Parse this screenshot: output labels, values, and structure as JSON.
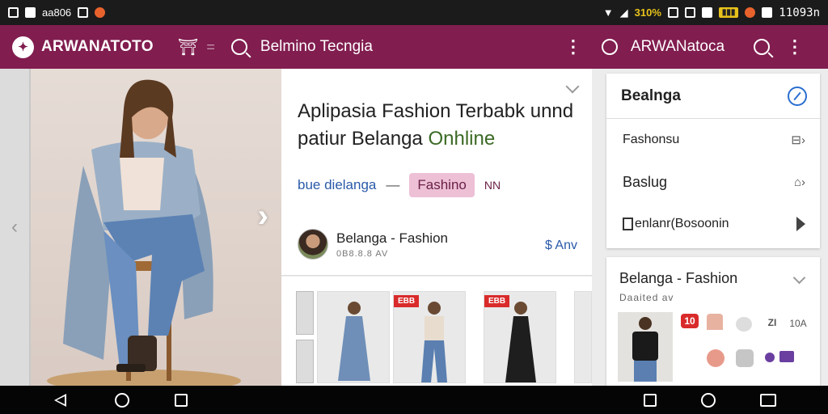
{
  "status_bar": {
    "left_text": "aa806",
    "battery_pct": "310%",
    "time": "11093n"
  },
  "topbar": {
    "brand_name": "ARWANATOTO",
    "search_text": "Belmino Tecngia",
    "right_title": "ARWANatoca",
    "kebab": "⋮"
  },
  "hero": {
    "next_label": "›",
    "prev_label": "‹"
  },
  "detail": {
    "headline_line1": "Aplipasia Fashion Terbabk unnd",
    "headline_line2_prefix": "patiur Belanga ",
    "headline_line2_highlight": "Onhline",
    "tag_link": "bue dielanga",
    "tag_dash": "—",
    "tag_chip": "Fashino",
    "tag_extra": "NN",
    "seller_name": "Belanga - Fashion",
    "seller_sub": "0B8.8.8 AV",
    "seller_link": "$ Anv"
  },
  "products": {
    "badge1": "EBB",
    "badge2": "EBB"
  },
  "right_panel": {
    "title": "Bealnga",
    "rows": [
      {
        "label": "Fashonsu",
        "icon": "⊟›"
      },
      {
        "label": "Baslug",
        "icon": "⌂›"
      },
      {
        "label": "enlanr(Bosoonin",
        "icon": ""
      }
    ]
  },
  "right_card": {
    "title": "Belanga - Fashion",
    "subtitle": "Daaited av",
    "badge": "10",
    "label_10a": "10A",
    "icon_text": "ZI"
  },
  "colors": {
    "topbar": "#811d4f",
    "chip": "#edc0d6",
    "link": "#2a5aa8",
    "badge": "#d92b2b"
  }
}
